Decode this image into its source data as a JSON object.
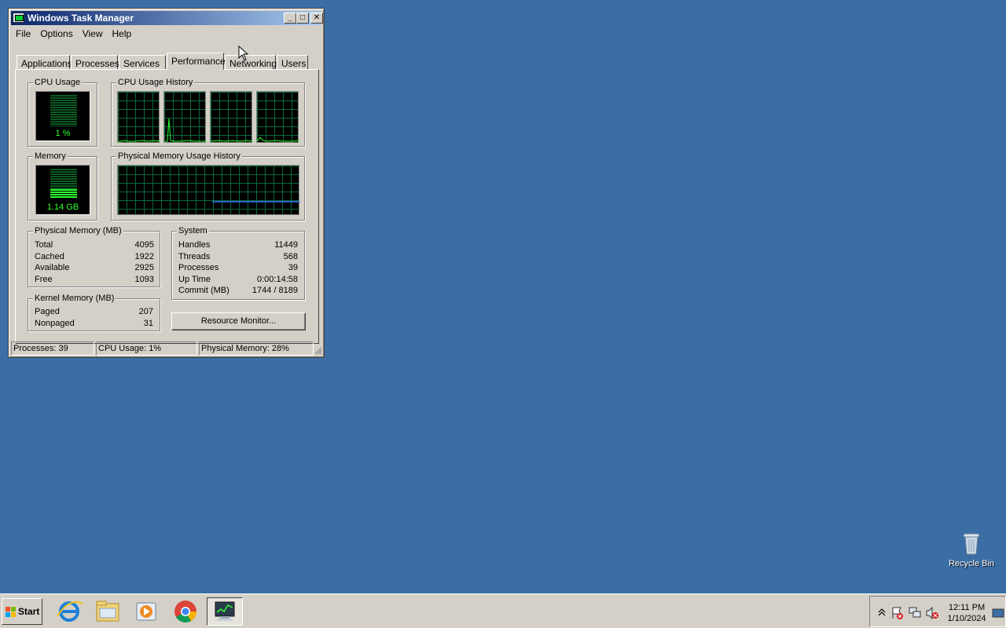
{
  "window": {
    "title": "Windows Task Manager",
    "minimize_label": "_",
    "maximize_label": "□",
    "close_label": "✕"
  },
  "menu": [
    "File",
    "Options",
    "View",
    "Help"
  ],
  "tabs": [
    {
      "label": "Applications"
    },
    {
      "label": "Processes"
    },
    {
      "label": "Services"
    },
    {
      "label": "Performance",
      "active": true
    },
    {
      "label": "Networking"
    },
    {
      "label": "Users"
    }
  ],
  "performance": {
    "cpu_usage": {
      "title": "CPU Usage",
      "value": "1 %"
    },
    "cpu_history": {
      "title": "CPU Usage History",
      "cores": 4
    },
    "memory": {
      "title": "Memory",
      "value": "1.14 GB"
    },
    "memory_history": {
      "title": "Physical Memory Usage History"
    },
    "physical_memory": {
      "title": "Physical Memory (MB)",
      "rows": [
        {
          "label": "Total",
          "value": "4095"
        },
        {
          "label": "Cached",
          "value": "1922"
        },
        {
          "label": "Available",
          "value": "2925"
        },
        {
          "label": "Free",
          "value": "1093"
        }
      ]
    },
    "kernel_memory": {
      "title": "Kernel Memory (MB)",
      "rows": [
        {
          "label": "Paged",
          "value": "207"
        },
        {
          "label": "Nonpaged",
          "value": "31"
        }
      ]
    },
    "system": {
      "title": "System",
      "rows": [
        {
          "label": "Handles",
          "value": "11449"
        },
        {
          "label": "Threads",
          "value": "568"
        },
        {
          "label": "Processes",
          "value": "39"
        },
        {
          "label": "Up Time",
          "value": "0:00:14:58"
        },
        {
          "label": "Commit (MB)",
          "value": "1744 / 8189"
        }
      ]
    },
    "resource_monitor_button": "Resource Monitor..."
  },
  "statusbar": {
    "processes": "Processes: 39",
    "cpu": "CPU Usage: 1%",
    "memory": "Physical Memory: 28%"
  },
  "desktop": {
    "recycle_bin_label": "Recycle Bin"
  },
  "taskbar": {
    "start_label": "Start",
    "apps": [
      "internet-explorer-icon",
      "file-explorer-icon",
      "media-player-icon",
      "chrome-icon",
      "task-manager-icon"
    ],
    "clock_time": "12:11 PM",
    "clock_date": "1/10/2024"
  },
  "colors": {
    "desktop": "#3a6ea5",
    "graph_green": "#2cff2c",
    "grid_green": "#0a6a3a",
    "memory_line": "#3c78ff"
  }
}
